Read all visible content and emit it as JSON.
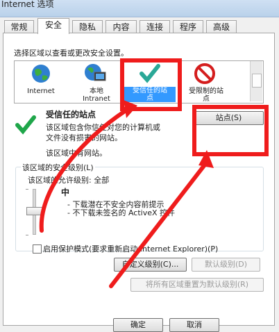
{
  "window": {
    "title": "Internet 选项"
  },
  "tabs": [
    {
      "label": "常规"
    },
    {
      "label": "安全"
    },
    {
      "label": "隐私"
    },
    {
      "label": "内容"
    },
    {
      "label": "连接"
    },
    {
      "label": "程序"
    },
    {
      "label": "高级"
    }
  ],
  "security": {
    "instruction": "选择区域以查看或更改安全设置。",
    "zones": [
      {
        "label": "Internet",
        "icon": "globe-icon"
      },
      {
        "label": "本地\nIntranet",
        "icon": "intranet-icon"
      },
      {
        "label": "受信任的站\n点",
        "icon": "check-icon"
      },
      {
        "label": "受限制的站\n点",
        "icon": "restricted-icon"
      }
    ],
    "selected_zone_title": "受信任的站点",
    "selected_zone_desc": "该区域包含你信任对您的计算机或\n文件没有损害的网站。",
    "zone_has_sites": "该区域中有网站。",
    "sites_button": "站点(S)",
    "level_group_title": "该区域的安全级别(L)",
    "allowed_levels": "该区域的允许级别: 全部",
    "level_name": "中",
    "level_bullets": [
      "- 下载潜在不安全内容前提示",
      "- 不下载未签名的 ActiveX 控件"
    ],
    "protected_mode_label": "启用保护模式(要求重新启动 Internet Explorer)(P)",
    "custom_level_button": "自定义级别(C)...",
    "default_level_button": "默认级别(D)",
    "reset_all_button": "将所有区域重置为默认级别(R)"
  },
  "footer": {
    "ok_button": "确定",
    "cancel_button": "取消"
  },
  "colors": {
    "highlight": "#3399ff",
    "annotation": "#ef1c1c"
  }
}
